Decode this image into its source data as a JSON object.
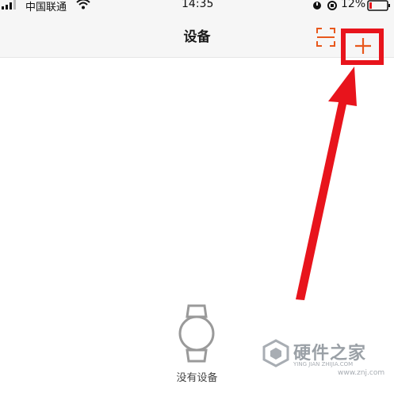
{
  "status_bar": {
    "carrier": "中国联通",
    "time": "14:35",
    "battery_percent": "12%"
  },
  "header": {
    "title": "设备"
  },
  "empty_state": {
    "message": "没有设备"
  },
  "watermark": {
    "title": "硬件之家",
    "pinyin": "YING JIAN ZHIJIA.COM",
    "url": "www.znj.com"
  },
  "colors": {
    "accent": "#e8581c",
    "highlight": "#e8141c",
    "nav_background": "#f6f6f6"
  },
  "icons": {
    "scan": "scan-icon",
    "add": "plus-icon",
    "empty": "watch-icon"
  }
}
